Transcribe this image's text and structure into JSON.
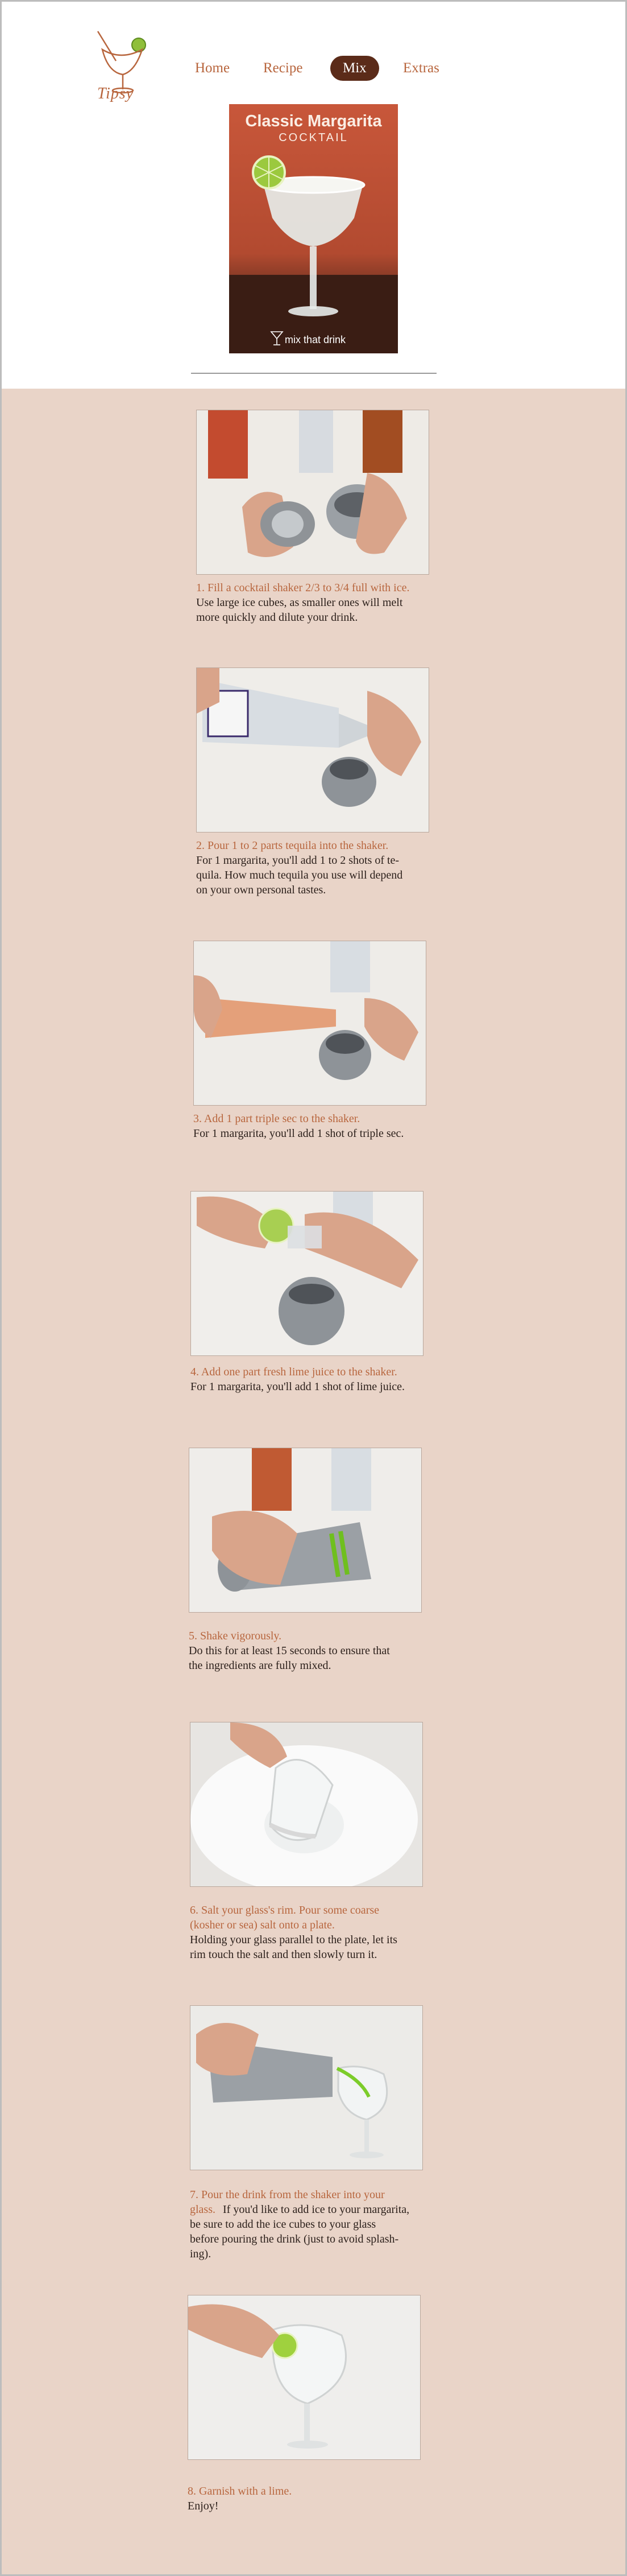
{
  "site": {
    "logo_text": "Tipsy"
  },
  "nav": {
    "items": [
      "Home",
      "Recipe",
      "Mix",
      "Extras"
    ],
    "active": "Mix"
  },
  "hero": {
    "title": "Classic Margarita",
    "subtitle": "COCKTAIL",
    "brand": "mix that drink"
  },
  "colors": {
    "accent": "#b8663e",
    "nav_active_bg": "#5b2b19",
    "content_bg": "#e9d4c8",
    "text": "#2b1f1a"
  },
  "steps": [
    {
      "title": [
        "1. Fill a cocktail shaker 2/3 to 3/4 full with ice."
      ],
      "text": [
        "Use large ice cubes, as smaller ones will melt",
        "more quickly and dilute your drink."
      ]
    },
    {
      "title": [
        "2. Pour 1 to 2 parts tequila into the shaker."
      ],
      "text": [
        "For 1 margarita, you'll add 1 to 2 shots of te-",
        "quila. How much tequila you use will depend",
        "on your own personal tastes."
      ]
    },
    {
      "title": [
        "3. Add 1 part triple sec to the shaker."
      ],
      "text": [
        "For 1 margarita, you'll add 1 shot of triple sec."
      ]
    },
    {
      "title": [
        "4. Add one part fresh lime juice to the shaker."
      ],
      "text": [
        "For 1 margarita, you'll add 1 shot of lime juice."
      ]
    },
    {
      "title": [
        "5. Shake vigorously."
      ],
      "text": [
        "Do this for at least 15 seconds to ensure that",
        "the ingredients are fully mixed."
      ]
    },
    {
      "title": [
        "6. Salt your glass's rim. Pour some coarse",
        "(kosher or sea) salt onto a plate."
      ],
      "text": [
        "Holding your glass parallel to the plate, let its",
        "rim touch the salt and then slowly turn it."
      ]
    },
    {
      "title": [
        "7. Pour the drink from the shaker into your",
        "glass."
      ],
      "title_inline_text": "If you'd like to add ice to your margarita,",
      "text": [
        "be sure to add the ice cubes to your glass",
        "before pouring the drink (just to avoid splash-",
        "ing)."
      ]
    },
    {
      "title": [
        "8. Garnish with a lime."
      ],
      "text": [
        "Enjoy!"
      ]
    }
  ]
}
